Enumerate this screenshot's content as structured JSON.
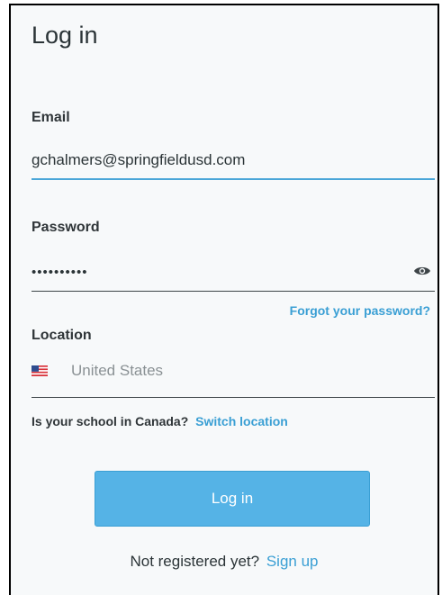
{
  "form": {
    "title": "Log in",
    "email": {
      "label": "Email",
      "value": "gchalmers@springfieldusd.com"
    },
    "password": {
      "label": "Password",
      "value": "••••••••••",
      "toggle_icon": "eye-icon"
    },
    "forgot_password_link": "Forgot your password?",
    "location": {
      "label": "Location",
      "value": "United States",
      "flag_icon": "us-flag-icon"
    },
    "canada_prompt": "Is your school in Canada?",
    "switch_location_link": "Switch location",
    "submit_label": "Log in",
    "register_prompt": "Not registered yet?",
    "signup_link": "Sign up"
  },
  "colors": {
    "accent": "#3a9fd4",
    "button": "#55b3e6",
    "active_underline": "#4aa6d8"
  }
}
